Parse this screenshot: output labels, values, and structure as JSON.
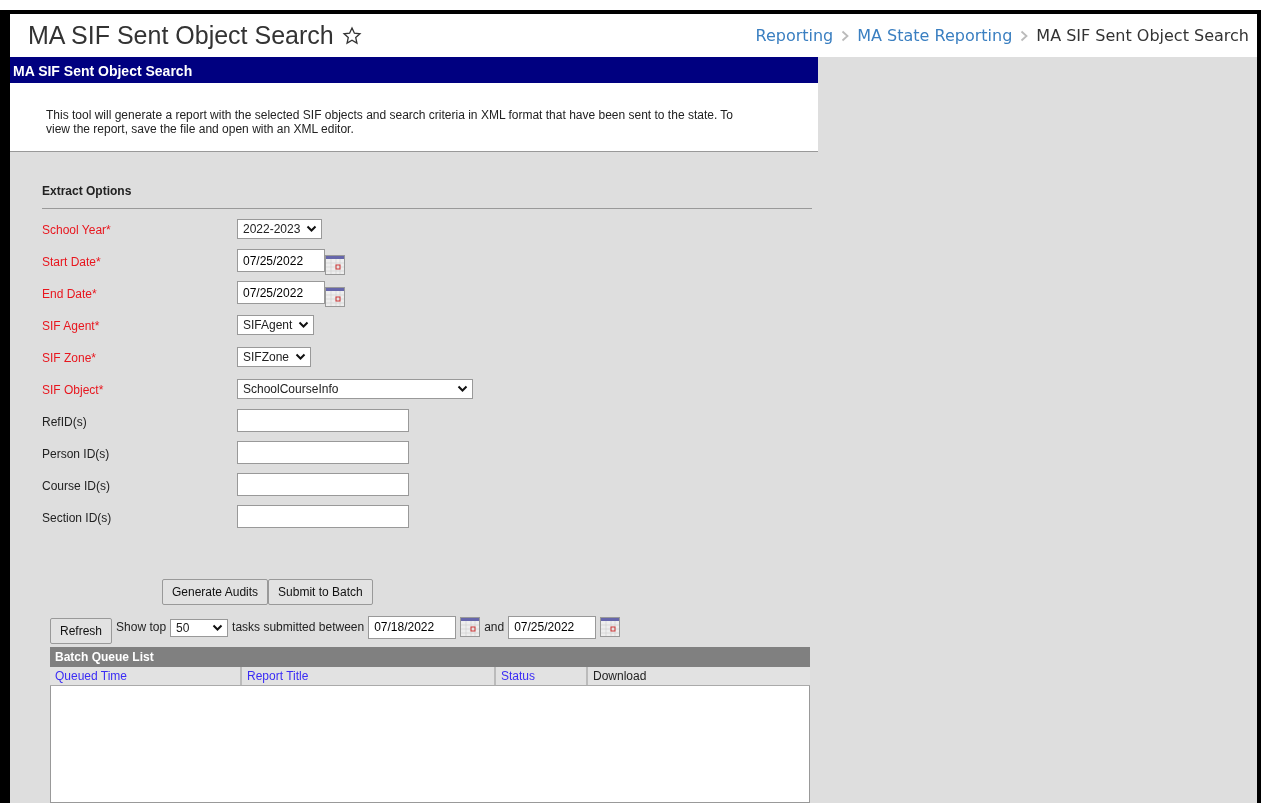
{
  "page": {
    "title": "MA SIF Sent Object Search"
  },
  "breadcrumb": [
    {
      "label": "Reporting",
      "current": false
    },
    {
      "label": "MA State Reporting",
      "current": false
    },
    {
      "label": "MA SIF Sent Object Search",
      "current": true
    }
  ],
  "panel": {
    "title": "MA SIF Sent Object Search",
    "description": "This tool will generate a report with the selected SIF objects and search criteria in XML format that have been sent to the state. To view the report, save the file and open with an XML editor."
  },
  "extract_options": {
    "heading": "Extract Options",
    "fields": [
      {
        "label": "School Year*",
        "required": true,
        "kind": "select",
        "value": "2022-2023"
      },
      {
        "label": "Start Date*",
        "required": true,
        "kind": "date",
        "value": "07/25/2022"
      },
      {
        "label": "End Date*",
        "required": true,
        "kind": "date",
        "value": "07/25/2022"
      },
      {
        "label": "SIF Agent*",
        "required": true,
        "kind": "select",
        "value": "SIFAgent"
      },
      {
        "label": "SIF Zone*",
        "required": true,
        "kind": "select",
        "value": "SIFZone"
      },
      {
        "label": "SIF Object*",
        "required": true,
        "kind": "select",
        "value": "SchoolCourseInfo"
      },
      {
        "label": "RefID(s)",
        "required": false,
        "kind": "text"
      },
      {
        "label": "Person ID(s)",
        "required": false,
        "kind": "text"
      },
      {
        "label": "Course ID(s)",
        "required": false,
        "kind": "text"
      },
      {
        "label": "Section ID(s)",
        "required": false,
        "kind": "text"
      }
    ]
  },
  "actions": [
    "Generate Audits",
    "Submit to Batch"
  ],
  "batch": {
    "refresh": "Refresh",
    "show_top": "Show top",
    "top_value": "50",
    "between": "tasks submitted between",
    "from": "07/18/2022",
    "and": "and",
    "to": "07/25/2022",
    "title": "Batch Queue List",
    "columns": [
      {
        "label": "Queued Time",
        "sortable": true
      },
      {
        "label": "Report Title",
        "sortable": true
      },
      {
        "label": "Status",
        "sortable": true
      },
      {
        "label": "Download",
        "sortable": false
      }
    ]
  }
}
